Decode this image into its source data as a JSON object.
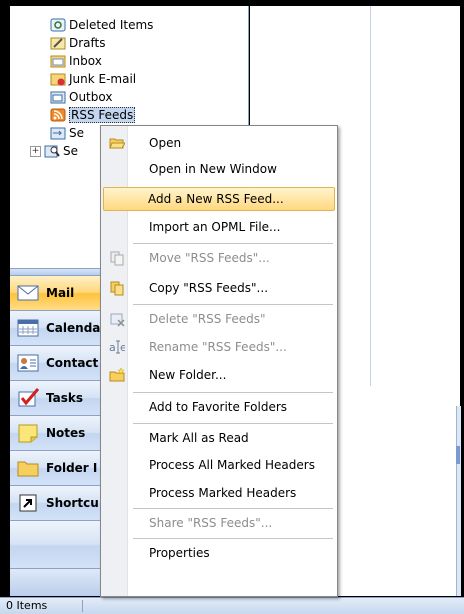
{
  "folders": [
    {
      "label": "Deleted Items",
      "icon": "deleted-items-icon"
    },
    {
      "label": "Drafts",
      "icon": "drafts-icon"
    },
    {
      "label": "Inbox",
      "icon": "inbox-icon"
    },
    {
      "label": "Junk E-mail",
      "icon": "junk-email-icon"
    },
    {
      "label": "Outbox",
      "icon": "outbox-icon"
    },
    {
      "label": "RSS Feeds",
      "icon": "rss-feeds-icon"
    },
    {
      "label": "Se",
      "icon": "sent-items-icon"
    },
    {
      "label": "Se",
      "icon": "search-folders-icon"
    }
  ],
  "nav_buttons": [
    {
      "label": "Mail",
      "icon": "mail-icon"
    },
    {
      "label": "Calenda",
      "icon": "calendar-icon"
    },
    {
      "label": "Contact",
      "icon": "contacts-icon"
    },
    {
      "label": "Tasks",
      "icon": "tasks-icon"
    },
    {
      "label": "Notes",
      "icon": "notes-icon"
    },
    {
      "label": "Folder I",
      "icon": "folder-list-icon"
    },
    {
      "label": "Shortcu",
      "icon": "shortcuts-icon"
    }
  ],
  "status": {
    "items": "0 Items"
  },
  "context_menu": {
    "items": [
      {
        "label": "Open",
        "icon": "open-folder-icon",
        "disabled": false
      },
      {
        "label": "Open in New Window",
        "disabled": false
      },
      {
        "label": "Add a New RSS Feed...",
        "disabled": false,
        "highlighted": true
      },
      {
        "label": "Import an OPML File...",
        "disabled": false
      },
      {
        "label": "Move \"RSS Feeds\"...",
        "icon": "move-icon",
        "disabled": true
      },
      {
        "label": "Copy \"RSS Feeds\"...",
        "icon": "copy-icon",
        "disabled": false
      },
      {
        "label": "Delete \"RSS Feeds\"",
        "icon": "delete-icon",
        "disabled": true
      },
      {
        "label": "Rename \"RSS Feeds\"...",
        "icon": "rename-icon",
        "disabled": true
      },
      {
        "label": "New Folder...",
        "icon": "new-folder-icon",
        "disabled": false
      },
      {
        "label": "Add to Favorite Folders",
        "disabled": false
      },
      {
        "label": "Mark All as Read",
        "disabled": false
      },
      {
        "label": "Process All Marked Headers",
        "disabled": false
      },
      {
        "label": "Process Marked Headers",
        "disabled": false
      },
      {
        "label": "Share \"RSS Feeds\"...",
        "disabled": true
      },
      {
        "label": "Properties",
        "disabled": false
      }
    ]
  },
  "colors": {
    "accent": "#ffc33a",
    "highlight": "#ffd880",
    "nav_blue": "#c3d6f0"
  }
}
